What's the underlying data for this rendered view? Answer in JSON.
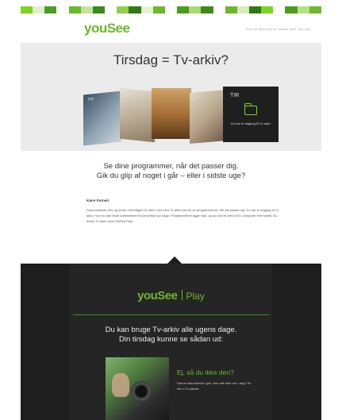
{
  "brand": {
    "logo_text": "youSee",
    "play_logo": "youSee",
    "play_label": "Play",
    "accent_color": "#6bb829",
    "dark_color": "#1e1e1e"
  },
  "header": {
    "top_link": "Hvis du ikke kan se denne mail, klik her"
  },
  "stripe_colors": [
    "#7ed321",
    "#dff0c9",
    "#4a9e1f",
    "#ffffff",
    "#6bb829",
    "#c2e49a",
    "#3d8a1a",
    "#ffffff",
    "#8fd14a",
    "#2f7a15",
    "#e4f4d0",
    "#6bb829",
    "#ffffff",
    "#4a9e1f",
    "#a8db74",
    "#3d8a1a",
    "#ffffff",
    "#6bb829",
    "#d4eeb6",
    "#2f7a15",
    "#7ed321",
    "#ffffff",
    "#4a9e1f",
    "#b6e284",
    "#6bb829"
  ],
  "hero": {
    "title": "Tirsdag = Tv-arkiv?",
    "tiles": [
      {
        "label": "TIR"
      },
      {
        "label": "TIR"
      },
      {
        "label": "TIR",
        "caption": "Du har fri adgang til Tv-arkiv"
      }
    ]
  },
  "lead": {
    "line1": "Se dine programmer, når det passer dig.",
    "line2": "Gik du glip af noget i går – eller i sidste uge?"
  },
  "body": {
    "greeting": "Kære Forneri",
    "text": "Dokumentarer, film og serier. Hverdagen er travl, men med Tv-arkiv kan du se programmerne, når det passer dig. Du har fri adgang til Tv-arkiv, hvor du kan finde udsendelser fra de sidste syv dage. Programmerne ligger klar, og du kan se dem på tv, computer eller tablet. Du finder Tv-arkiv med YouSee Play."
  },
  "play_section": {
    "title_line1": "Du kan bruge Tv-arkiv alle ugens dage.",
    "title_line2": "Din tirsdag kunne se sådan ud:",
    "feature_title": "Ej, så du ikke den?",
    "feature_text": "Denne dokumentar i går, som alle taler om i dag? Se den i Tv-arkivet."
  }
}
